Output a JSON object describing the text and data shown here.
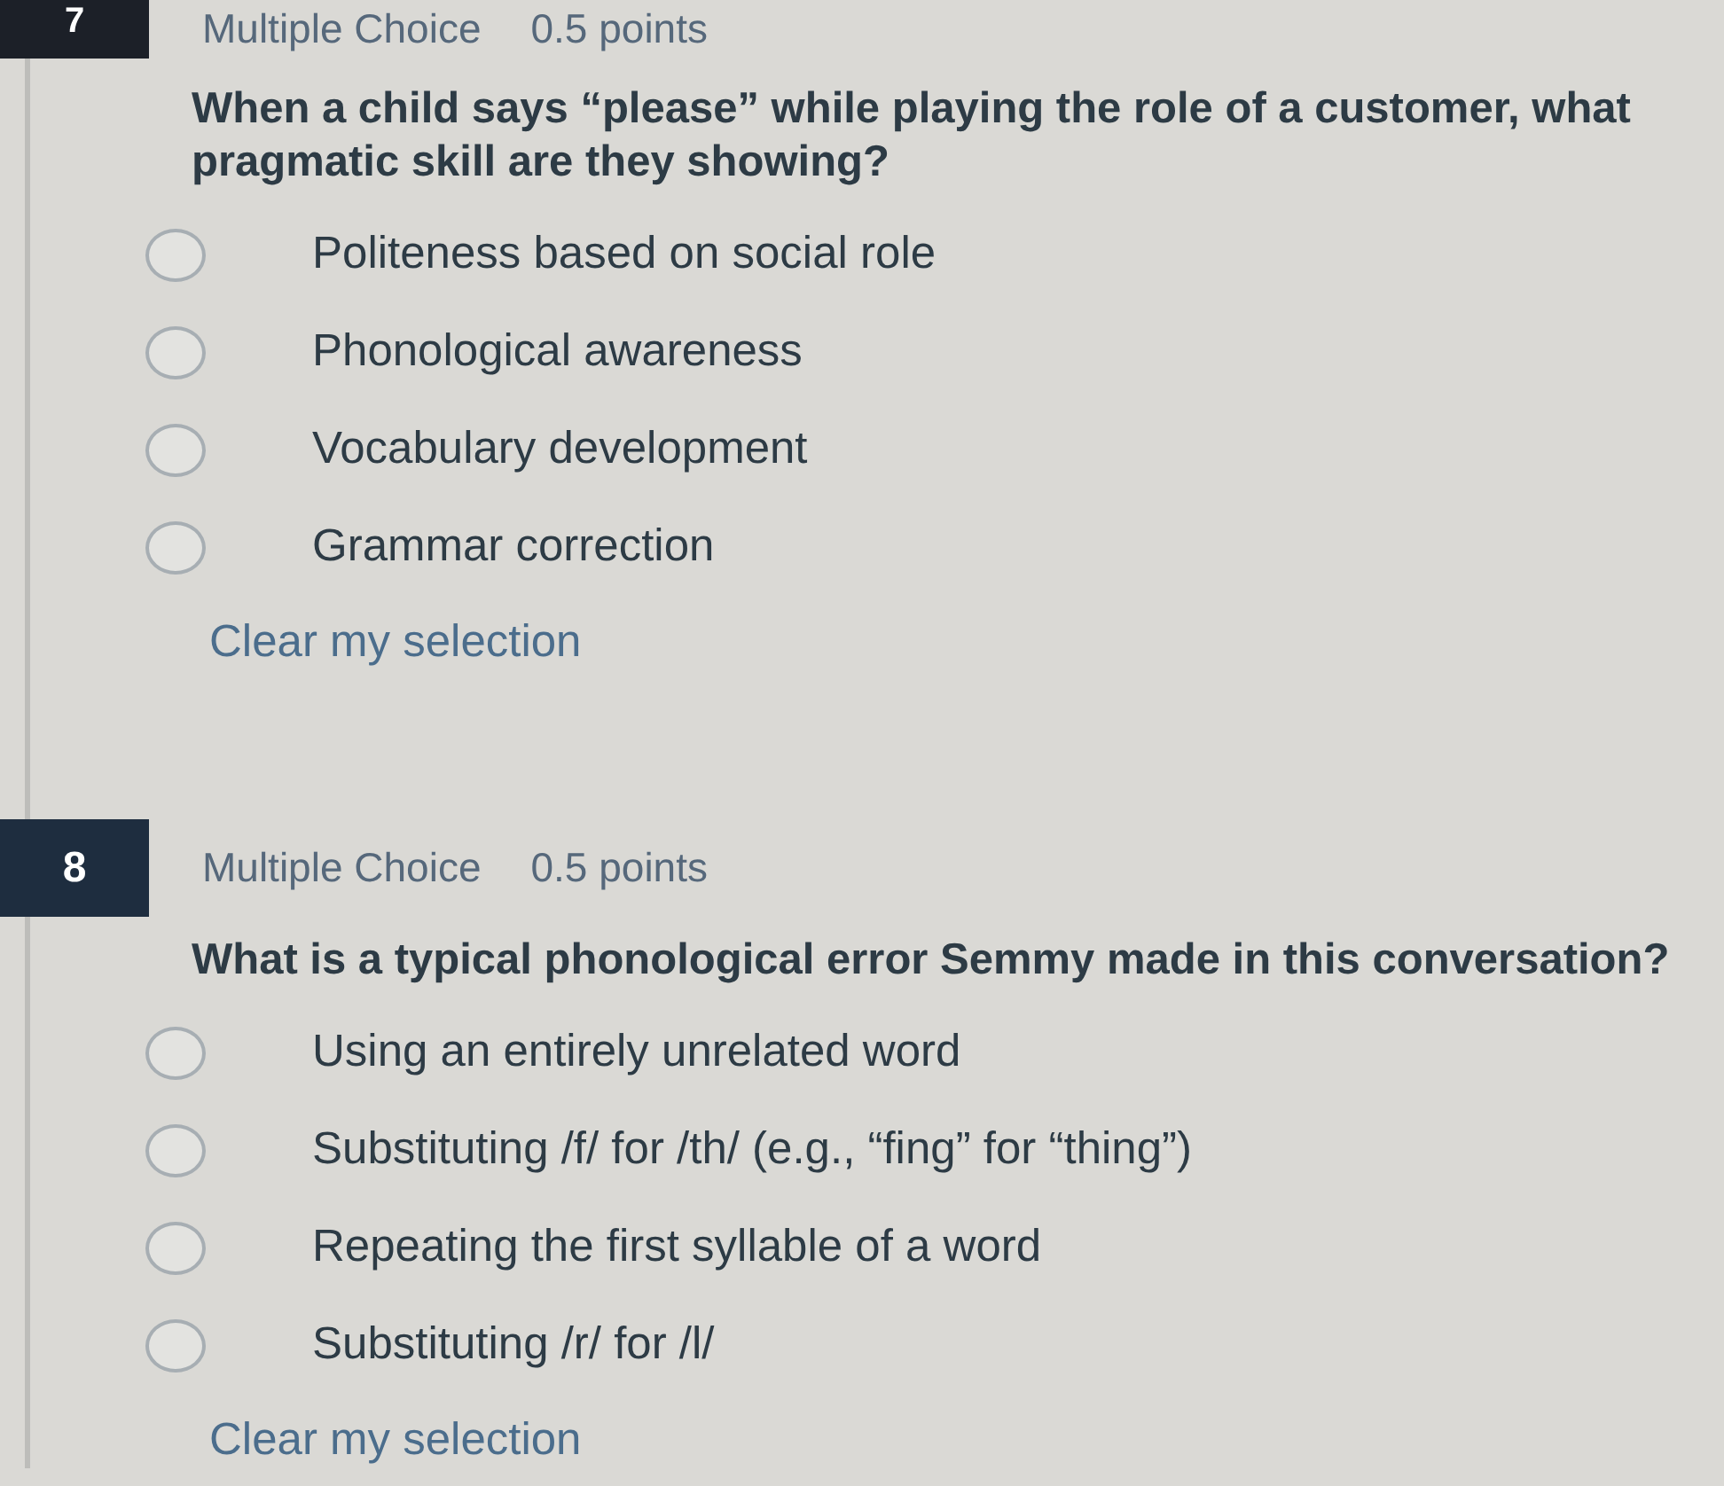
{
  "questions": [
    {
      "number": "7",
      "type": "Multiple Choice",
      "points": "0.5 points",
      "prompt": "When a child says “please” while playing the role of a customer, what pragmatic skill are they showing?",
      "options": [
        {
          "label": "Politeness based on social role",
          "selected": false
        },
        {
          "label": "Phonological awareness",
          "selected": false
        },
        {
          "label": "Vocabulary development",
          "selected": false
        },
        {
          "label": "Grammar correction",
          "selected": false
        }
      ],
      "clear_link": "Clear my selection"
    },
    {
      "number": "8",
      "type": "Multiple Choice",
      "points": "0.5 points",
      "prompt": "What is a typical phonological error Semmy made in this conversation?",
      "options": [
        {
          "label": "Using an entirely unrelated word",
          "selected": false
        },
        {
          "label": "Substituting /f/ for /th/ (e.g., “fing” for “thing”)",
          "selected": false
        },
        {
          "label": "Repeating the first syllable of a word",
          "selected": false
        },
        {
          "label": "Substituting /r/ for /l/",
          "selected": false
        }
      ],
      "clear_link": "Clear my selection"
    }
  ]
}
